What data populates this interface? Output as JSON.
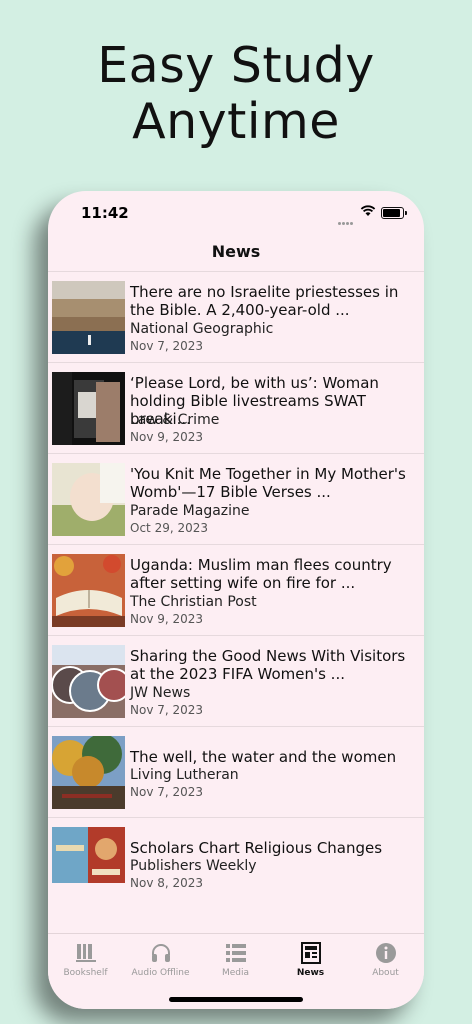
{
  "promo": {
    "headline_line1": "Easy Study",
    "headline_line2": "Anytime"
  },
  "status_bar": {
    "time": "11:42"
  },
  "nav": {
    "title": "News"
  },
  "news": [
    {
      "title": "There are no Israelite priestesses in the Bible. A 2,400-year-old ...",
      "source": "National Geographic",
      "date": "Nov 7, 2023",
      "thumb_icon": "harbor-photo"
    },
    {
      "title": "‘Please Lord, be with us’: Woman holding Bible livestreams SWAT breaki...",
      "source": "Law & Crime",
      "date": "Nov 9, 2023",
      "thumb_icon": "livestream-photo"
    },
    {
      "title": "'You Knit Me Together in My Mother's Womb'—17 Bible Verses ...",
      "source": "Parade Magazine",
      "date": "Oct 29, 2023",
      "thumb_icon": "pregnancy-photo"
    },
    {
      "title": "Uganda: Muslim man flees country after setting wife on fire for ...",
      "source": "The Christian Post",
      "date": "Nov 9, 2023",
      "thumb_icon": "open-bible-photo"
    },
    {
      "title": "Sharing the Good News With Visitors at the 2023 FIFA Women's ...",
      "source": "JW News",
      "date": "Nov 7, 2023",
      "thumb_icon": "street-collage-photo"
    },
    {
      "title": "The well, the water and the women",
      "source": "Living Lutheran",
      "date": "Nov 7, 2023",
      "thumb_icon": "autumn-trees-photo"
    },
    {
      "title": "Scholars Chart Religious Changes",
      "source": "Publishers Weekly",
      "date": "Nov 8, 2023",
      "thumb_icon": "book-covers-photo"
    }
  ],
  "tabs": [
    {
      "label": "Bookshelf",
      "icon": "bookshelf-icon",
      "active": false
    },
    {
      "label": "Audio Offline",
      "icon": "headphones-icon",
      "active": false
    },
    {
      "label": "Media",
      "icon": "list-icon",
      "active": false
    },
    {
      "label": "News",
      "icon": "newspaper-icon",
      "active": true
    },
    {
      "label": "About",
      "icon": "info-icon",
      "active": false
    }
  ],
  "colors": {
    "background": "#d3efe3",
    "phone_surface": "#fdeef3",
    "tab_inactive": "#9a9a9a",
    "tab_active": "#111111"
  }
}
